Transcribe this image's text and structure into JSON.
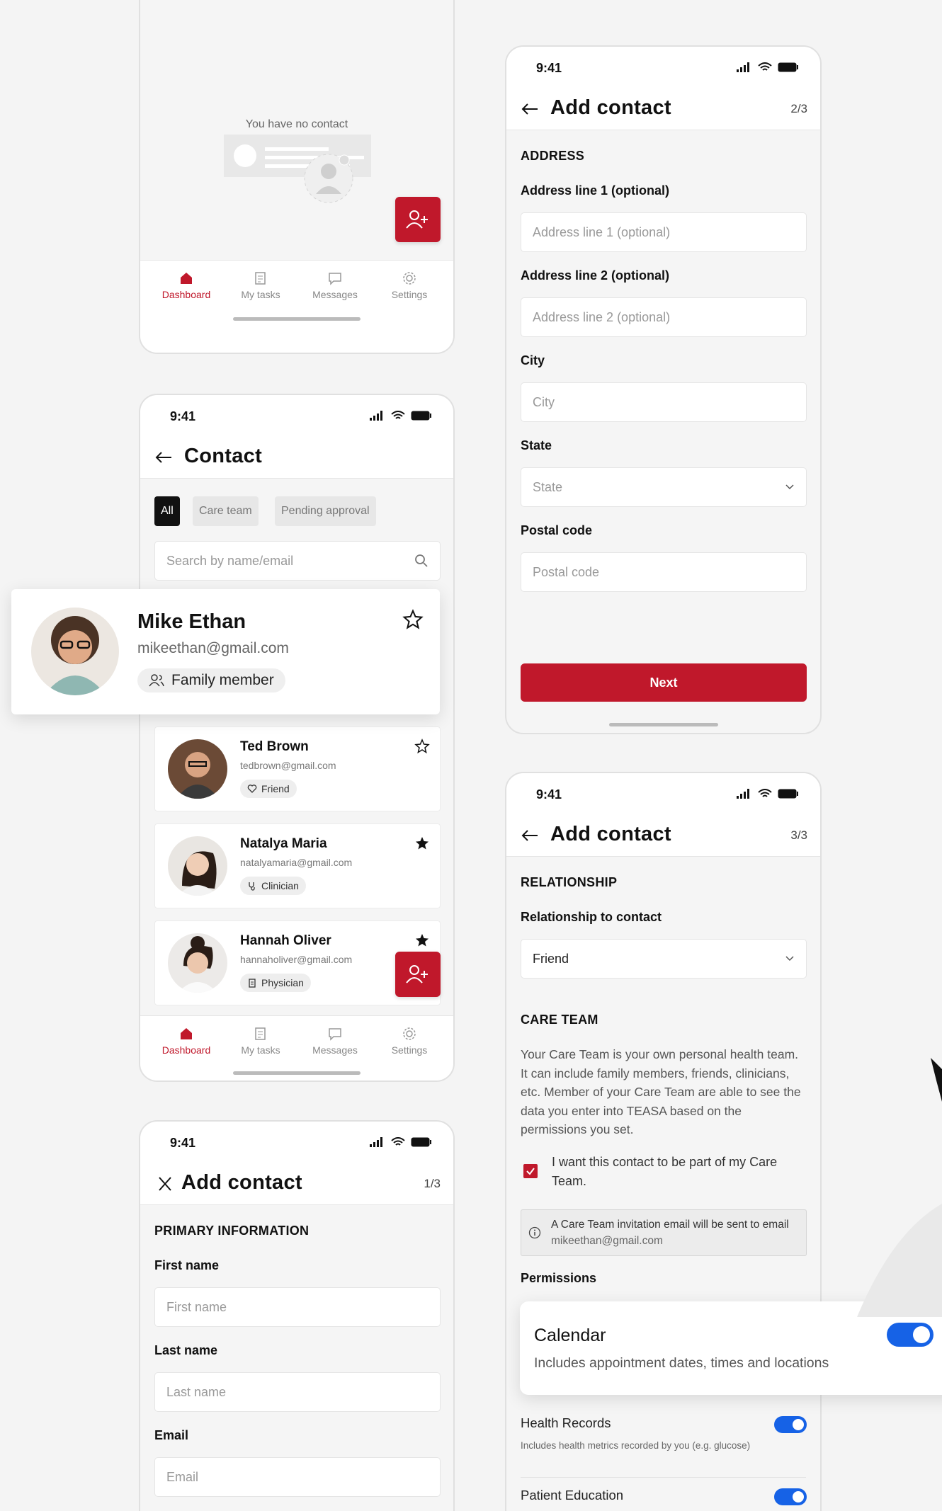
{
  "status_time": "9:41",
  "colors": {
    "brand": "#c0182b",
    "toggle": "#1662e6",
    "chip_active": "#111111"
  },
  "nav": {
    "items": [
      {
        "label": "Dashboard",
        "icon": "home-icon"
      },
      {
        "label": "My tasks",
        "icon": "tasks-icon"
      },
      {
        "label": "Messages",
        "icon": "messages-icon"
      },
      {
        "label": "Settings",
        "icon": "settings-icon"
      }
    ]
  },
  "empty": {
    "text": "You have no contact"
  },
  "contact": {
    "title": "Contact",
    "filters": [
      "All",
      "Care team",
      "Pending approval"
    ],
    "search_placeholder": "Search by name/email",
    "featured": {
      "name": "Mike Ethan",
      "email": "mikeethan@gmail.com",
      "tag": "Family member"
    },
    "list": [
      {
        "name": "Ted Brown",
        "email": "tedbrown@gmail.com",
        "tag": "Friend",
        "starred": false
      },
      {
        "name": "Natalya Maria",
        "email": "natalyamaria@gmail.com",
        "tag": "Clinician",
        "starred": true
      },
      {
        "name": "Hannah Oliver",
        "email": "hannaholiver@gmail.com",
        "tag": "Physician",
        "starred": true
      }
    ]
  },
  "add1": {
    "title": "Add contact",
    "step": "1/3",
    "section": "PRIMARY INFORMATION",
    "first_label": "First name",
    "first_placeholder": "First name",
    "last_label": "Last name",
    "last_placeholder": "Last name",
    "email_label": "Email",
    "email_placeholder": "Email"
  },
  "add2": {
    "title": "Add contact",
    "step": "2/3",
    "section": "ADDRESS",
    "addr1_label": "Address line 1 (optional)",
    "addr1_placeholder": "Address line 1 (optional)",
    "addr2_label": "Address line 2 (optional)",
    "addr2_placeholder": "Address line 2 (optional)",
    "city_label": "City",
    "city_placeholder": "City",
    "state_label": "State",
    "state_placeholder": "State",
    "postal_label": "Postal code",
    "postal_placeholder": "Postal code",
    "next_label": "Next"
  },
  "add3": {
    "title": "Add contact",
    "step": "3/3",
    "section": "RELATIONSHIP",
    "rel_label": "Relationship to contact",
    "rel_value": "Friend",
    "care_section": "CARE TEAM",
    "care_desc": "Your Care Team is your own personal health team. It can include family members, friends, clinicians, etc. Member of your Care Team are able to see the data you enter into TEASA based on the permissions you set.",
    "checkbox_label": "I want this contact to be part of my Care Team.",
    "checkbox_checked": true,
    "info_prefix": "A Care Team invitation email will be sent to email",
    "info_email": "mikeethan@gmail.com",
    "permissions_label": "Permissions",
    "calendar": {
      "title": "Calendar",
      "desc": "Includes appointment dates, times and locations",
      "on": true
    },
    "health": {
      "title": "Health Records",
      "desc": "Includes health metrics recorded by you (e.g. glucose)",
      "on": true
    },
    "education": {
      "title": "Patient Education",
      "on": true
    }
  }
}
